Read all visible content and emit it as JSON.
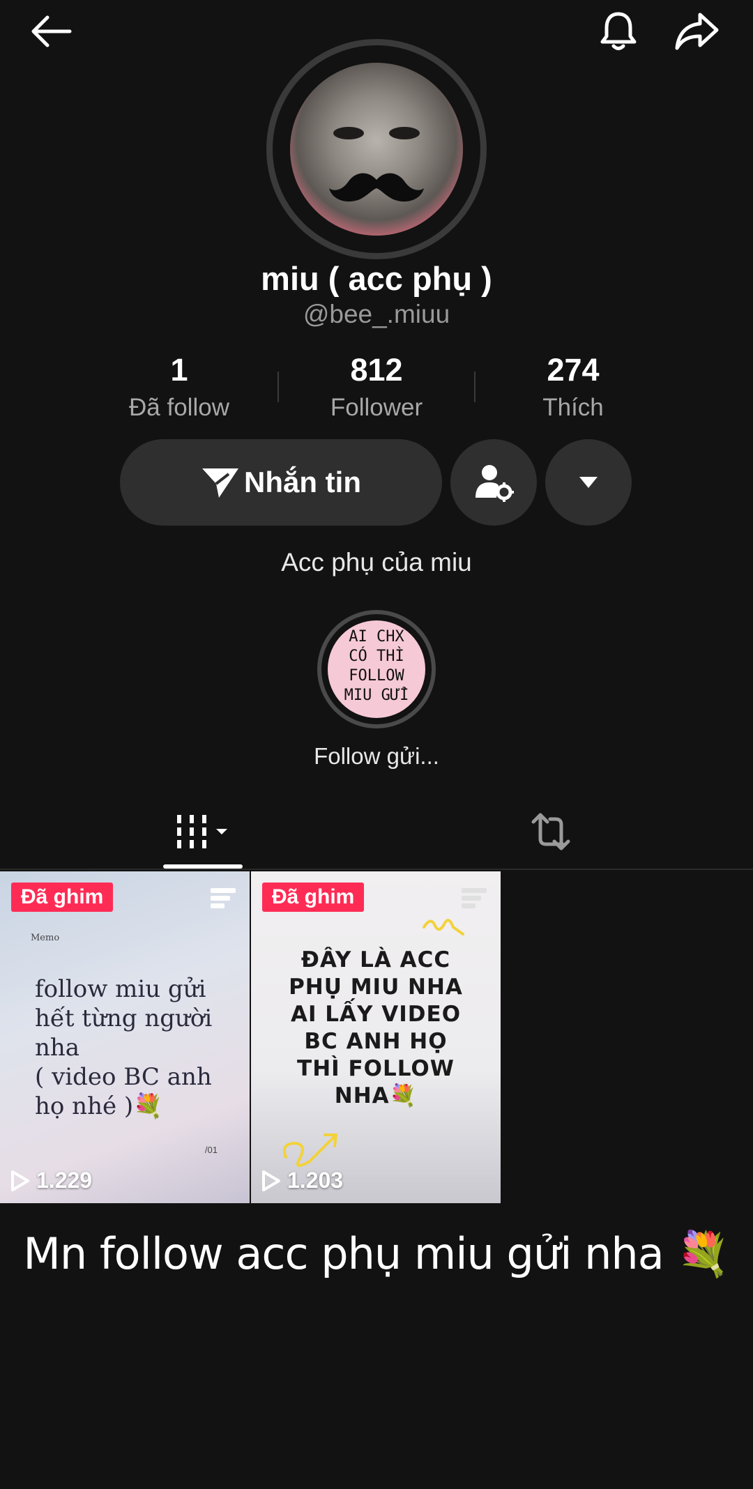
{
  "profile": {
    "display_name": "miu ( acc phụ )",
    "username": "@bee_.miuu",
    "bio": "Acc phụ của miu"
  },
  "stats": {
    "following_count": "1",
    "following_label": "Đã follow",
    "followers_count": "812",
    "followers_label": "Follower",
    "likes_count": "274",
    "likes_label": "Thích"
  },
  "actions": {
    "message_label": "Nhắn tin"
  },
  "highlight": {
    "cover_lines": [
      "AI CHX",
      "CÓ THÌ",
      "FOLLOW",
      "MIU GỬI"
    ],
    "label": "Follow gửi..."
  },
  "videos": [
    {
      "badge": "Đã ghim",
      "memo": "Memo",
      "text_lines": [
        "follow miu gửi",
        "hết từng người",
        "nha",
        "( video BC anh",
        "họ nhé )💐"
      ],
      "page": "/01",
      "views": "1.229"
    },
    {
      "badge": "Đã ghim",
      "text_lines": [
        "ĐÂY LÀ ACC",
        "PHỤ MIU NHA",
        "AI LẤY VIDEO",
        "BC ANH HỌ",
        "THÌ FOLLOW",
        "NHA💐"
      ],
      "views": "1.203"
    }
  ],
  "caption": "Mn follow acc phụ miu gửi nha 💐",
  "colors": {
    "background": "#121212",
    "button": "#2f2f2f",
    "pin_badge": "#fe2c55",
    "muted_text": "#a8a8a8"
  },
  "icons": [
    "back-arrow-icon",
    "bell-icon",
    "share-icon",
    "send-icon",
    "add-friend-gear-icon",
    "chevron-down-icon",
    "grid-icon",
    "repost-icon",
    "play-icon",
    "menu-icon"
  ]
}
